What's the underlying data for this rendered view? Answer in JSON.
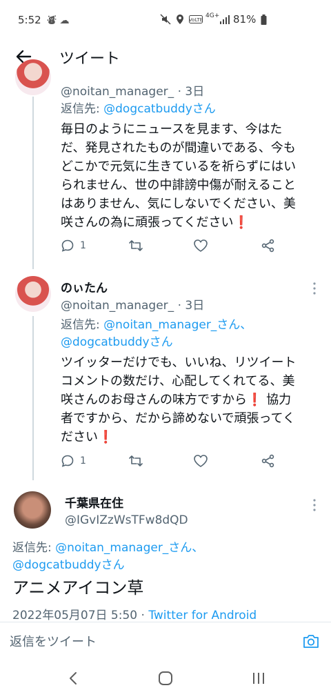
{
  "status_bar": {
    "time": "5:52",
    "network": "4G+",
    "battery": "81%",
    "icons": [
      "notification-icon",
      "mute-icon",
      "location-icon",
      "volte-icon",
      "signal-icon",
      "battery-icon"
    ]
  },
  "header": {
    "title": "ツイート",
    "back_icon": "back-arrow-icon"
  },
  "tweets": [
    {
      "handle": "@noitan_manager_",
      "time": "3日",
      "reply_prefix": "返信先: ",
      "reply_to": "@dogcatbuddyさん",
      "text_lines": [
        "毎日のようにニュースを見ます、今はた",
        "だ、発見されたものが間違いである、今も",
        "どこかで元気に生きているを祈らずにはい",
        "られません、世の中誹謗中傷が耐えること",
        "はありません、気にしないでください、美",
        "咲さんの為に頑張ってください❗"
      ],
      "reply_count": "1"
    },
    {
      "name": "のぃたん",
      "handle": "@noitan_manager_",
      "time": "3日",
      "reply_prefix": "返信先: ",
      "reply_to_1": "@noitan_manager_さん、",
      "reply_to_2": "@dogcatbuddyさん",
      "text_lines": [
        "ツイッターだけでも、いいね、リツイート",
        "コメントの数だけ、心配してくれてる、美",
        "咲さんのお母さんの味方ですから❗ 協力",
        "者ですから、だから諦めないで頑張ってく",
        "ださい❗"
      ],
      "reply_count": "1"
    }
  ],
  "main_tweet": {
    "name": "千葉県在住",
    "handle": "@IGvIZzWsTFw8dQD",
    "reply_prefix": "返信先: ",
    "reply_to_1": "@noitan_manager_さん、",
    "reply_to_2": "@dogcatbuddyさん",
    "text": "アニメアイコン草",
    "date": "2022年05月07日 5:50",
    "separator": " · ",
    "client": "Twitter for Android"
  },
  "reply_bar": {
    "placeholder": "返信をツイート"
  },
  "colors": {
    "link": "#1d9bf0",
    "secondary_text": "#536471",
    "primary_text": "#0f1419",
    "thread_line": "#cfd9de"
  }
}
